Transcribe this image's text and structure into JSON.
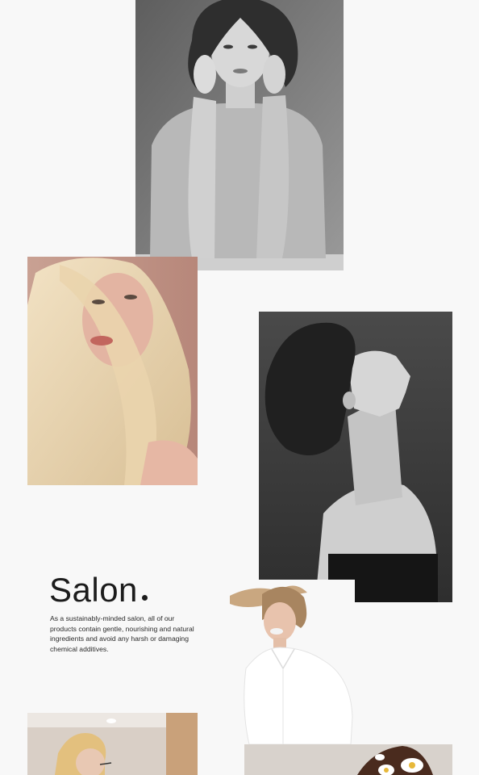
{
  "salon": {
    "title": "Salon",
    "description": "As a sustainably-minded salon, all of our products contain gentle, nourishing and natural ingredients and avoid any harsh or damaging chemical additives."
  },
  "photos": [
    {
      "name": "curly-hair-portrait-photo",
      "tone": "monochrome"
    },
    {
      "name": "blonde-hair-portrait-photo",
      "tone": "warm"
    },
    {
      "name": "updo-profile-portrait-photo",
      "tone": "monochrome"
    },
    {
      "name": "windblown-hair-laughing-photo",
      "tone": "light"
    },
    {
      "name": "salon-interior-photo",
      "tone": "warm"
    },
    {
      "name": "floral-hair-photo",
      "tone": "light"
    }
  ]
}
